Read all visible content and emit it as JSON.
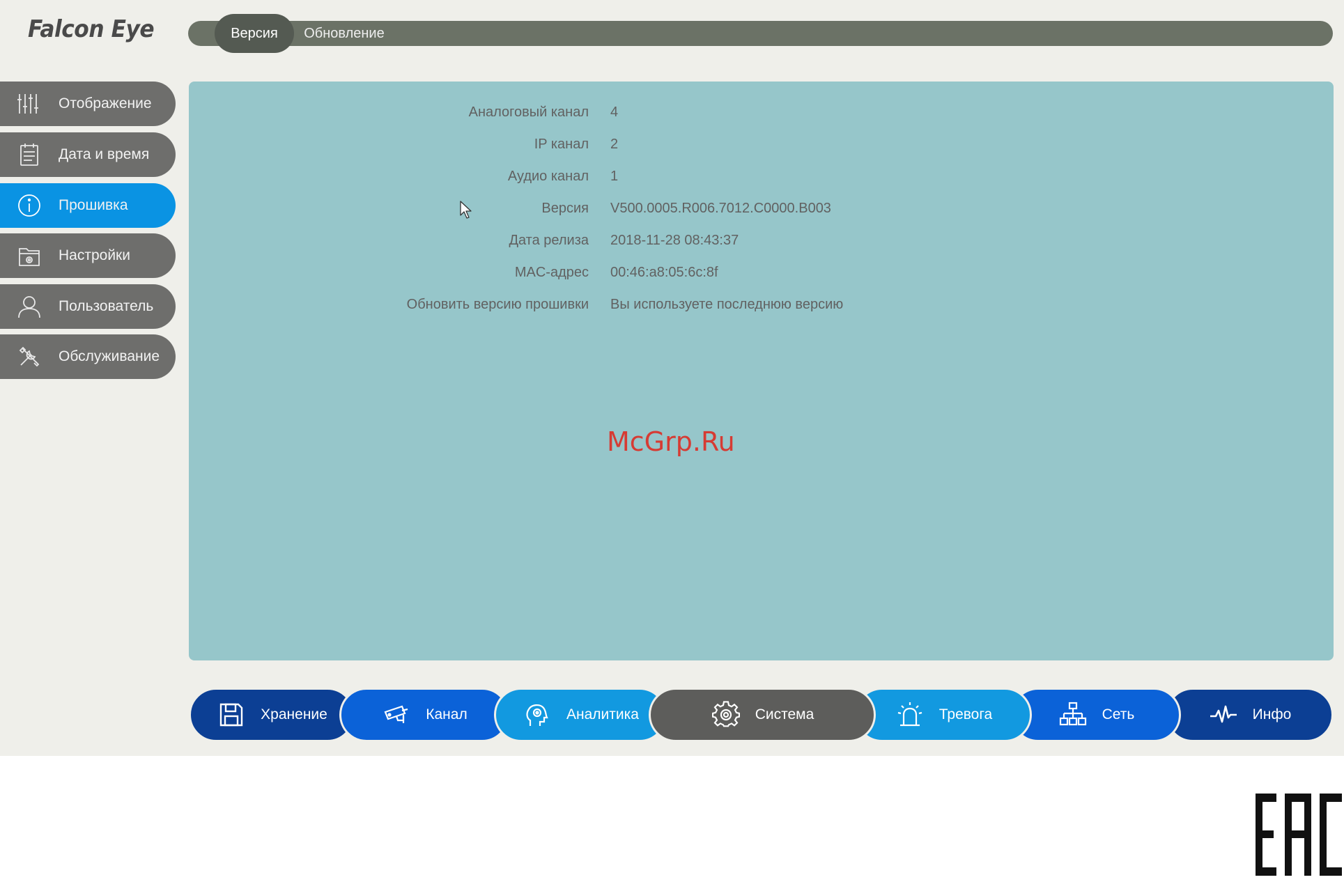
{
  "logo": "Falcon Eye",
  "top_tabs": [
    {
      "label": "Версия",
      "active": true
    },
    {
      "label": "Обновление",
      "active": false
    }
  ],
  "sidebar": {
    "items": [
      {
        "label": "Отображение",
        "icon": "sliders-icon",
        "active": false
      },
      {
        "label": "Дата и время",
        "icon": "calendar-icon",
        "active": false
      },
      {
        "label": "Прошивка",
        "icon": "info-icon",
        "active": true
      },
      {
        "label": "Настройки",
        "icon": "settings-folder-icon",
        "active": false
      },
      {
        "label": "Пользователь",
        "icon": "user-icon",
        "active": false
      },
      {
        "label": "Обслуживание",
        "icon": "tools-icon",
        "active": false
      }
    ]
  },
  "info": {
    "rows": [
      {
        "label": "Аналоговый канал",
        "value": "4"
      },
      {
        "label": "IP канал",
        "value": "2"
      },
      {
        "label": "Аудио канал",
        "value": "1"
      },
      {
        "label": "Версия",
        "value": "V500.0005.R006.7012.C0000.B003"
      },
      {
        "label": "Дата релиза",
        "value": "2018-11-28 08:43:37"
      },
      {
        "label": "MAC-адрес",
        "value": "00:46:a8:05:6c:8f"
      },
      {
        "label": "Обновить версию прошивки",
        "value": "Вы используете последнюю версию"
      }
    ]
  },
  "watermark": "McGrp.Ru",
  "bottom_nav": [
    {
      "label": "Хранение",
      "icon": "floppy-icon",
      "color": "#0c3f94"
    },
    {
      "label": "Канал",
      "icon": "camera-icon",
      "color": "#0b62d8"
    },
    {
      "label": "Аналитика",
      "icon": "brain-icon",
      "color": "#1299e0"
    },
    {
      "label": "Система",
      "icon": "gear-icon",
      "color": "#5d5d5b"
    },
    {
      "label": "Тревога",
      "icon": "alarm-icon",
      "color": "#1299e0"
    },
    {
      "label": "Сеть",
      "icon": "network-icon",
      "color": "#0b62d8"
    },
    {
      "label": "Инфо",
      "icon": "pulse-icon",
      "color": "#0c3f94"
    }
  ],
  "certification_mark": "EAC",
  "colors": {
    "accent": "#0a93e3",
    "panel": "#96c6ca",
    "sidebar": "#6e6e6c",
    "tabbar": "#6b7266"
  }
}
